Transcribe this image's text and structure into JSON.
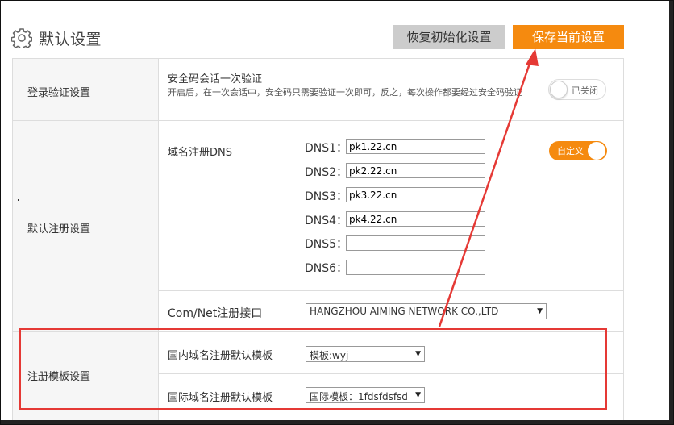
{
  "header": {
    "title": "默认设置",
    "reset_label": "恢复初始化设置",
    "save_label": "保存当前设置"
  },
  "login": {
    "label": "登录验证设置",
    "title": "安全码会话一次验证",
    "desc": "开启后，在一次会话中，安全码只需要验证一次即可，反之，每次操作都要经过安全码验证",
    "toggle": "已关闭"
  },
  "register": {
    "label": "默认注册设置",
    "dns_title": "域名注册DNS",
    "toggle": "自定义",
    "dns": [
      {
        "label": "DNS1：",
        "value": "pk1.22.cn"
      },
      {
        "label": "DNS2：",
        "value": "pk2.22.cn"
      },
      {
        "label": "DNS3：",
        "value": "pk3.22.cn"
      },
      {
        "label": "DNS4：",
        "value": "pk4.22.cn"
      },
      {
        "label": "DNS5：",
        "value": ""
      },
      {
        "label": "DNS6：",
        "value": ""
      }
    ],
    "comnet_label": "Com/Net注册接口",
    "comnet_value": "HANGZHOU AIMING NETWORK CO.,LTD"
  },
  "template": {
    "label": "注册模板设置",
    "domestic_label": "国内域名注册默认模板",
    "domestic_value": "模板:wyj",
    "intl_label": "国际域名注册默认模板",
    "intl_value": "国际模板：1fdsfdsfsd"
  },
  "colors": {
    "accent": "#f58a0f",
    "annotation": "#e53935"
  }
}
